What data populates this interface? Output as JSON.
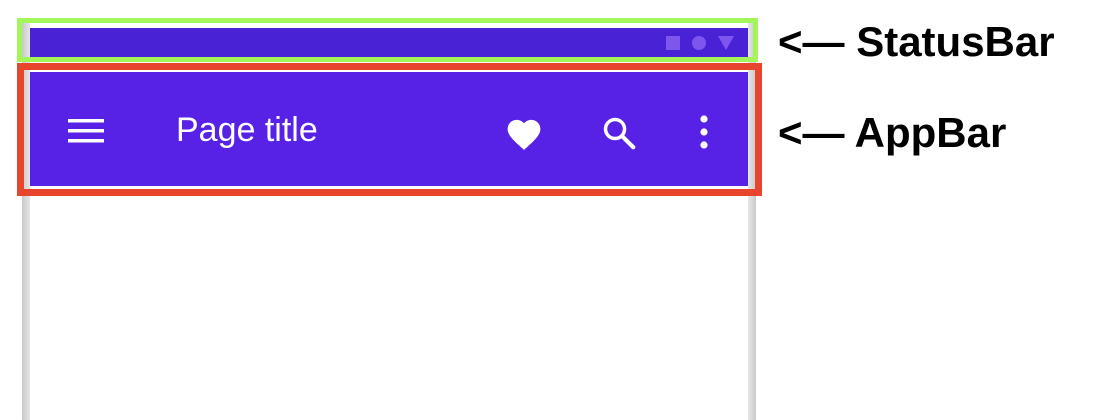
{
  "annotations": {
    "status_bar_label": "<— StatusBar",
    "app_bar_label": "<— AppBar"
  },
  "appbar": {
    "title": "Page title",
    "icons": [
      "menu-icon",
      "heart-icon",
      "search-icon",
      "more-vert-icon"
    ]
  },
  "statusbar": {
    "icons": [
      "square-icon",
      "circle-icon",
      "triangle-icon"
    ]
  },
  "colors": {
    "status_bar": "#4a22d6",
    "app_bar": "#5722e6",
    "statusbar_frame": "#a3f55a",
    "appbar_frame": "#e8452f"
  }
}
